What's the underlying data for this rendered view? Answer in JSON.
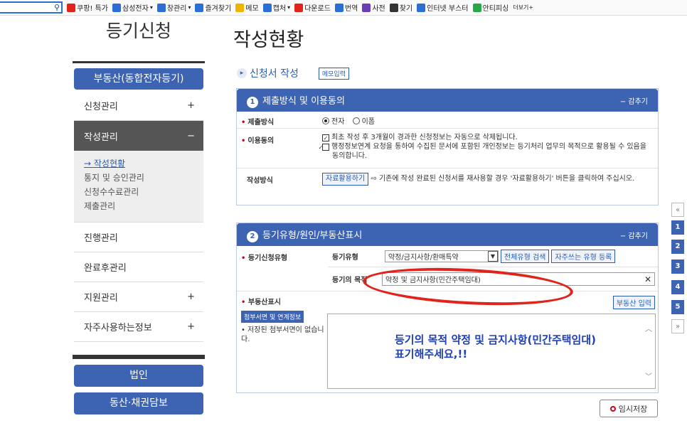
{
  "toolbar": {
    "items": [
      {
        "label": "쿠팡! 특가",
        "icon": "coupang-icon",
        "color": "#e0231b"
      },
      {
        "label": "삼성전자",
        "icon": "samsung-icon",
        "color": "#2b6fd6",
        "caret": true
      },
      {
        "label": "창관리",
        "icon": "window-icon",
        "color": "#2b6fd6",
        "caret": true
      },
      {
        "label": "즐겨찾기",
        "icon": "star-icon",
        "color": "#2b6fd6"
      },
      {
        "label": "메모",
        "icon": "memo-icon",
        "color": "#f0b400"
      },
      {
        "label": "캡처",
        "icon": "capture-icon",
        "color": "#2b6fd6",
        "caret": true
      },
      {
        "label": "다운로드",
        "icon": "download-icon",
        "color": "#e0231b"
      },
      {
        "label": "번역",
        "icon": "translate-icon",
        "color": "#2b6fd6"
      },
      {
        "label": "사전",
        "icon": "dictionary-icon",
        "color": "#6a3fb5"
      },
      {
        "label": "찾기",
        "icon": "find-icon",
        "color": "#333333"
      },
      {
        "label": "인터넷 부스터",
        "icon": "booster-icon",
        "color": "#2b6fd6"
      },
      {
        "label": "안티피싱",
        "icon": "shield-icon",
        "color": "#27a844"
      },
      {
        "label": "더보기+",
        "icon": "",
        "color": ""
      }
    ]
  },
  "sidebar": {
    "title": "등기신청",
    "category": "부동산(동합전자등기)",
    "menu": [
      {
        "label": "신청관리",
        "sign": "+"
      },
      {
        "label": "작성관리",
        "sign": "−",
        "active": true
      }
    ],
    "submenu": [
      "작성현황",
      "통지 및 승인관리",
      "신청수수료관리",
      "제출관리"
    ],
    "menu2": [
      {
        "label": "진행관리",
        "sign": ""
      },
      {
        "label": "완료후관리",
        "sign": ""
      },
      {
        "label": "지원관리",
        "sign": "+"
      },
      {
        "label": "자주사용하는정보",
        "sign": "+"
      }
    ],
    "buttons": [
      "법인",
      "동산·채권담보"
    ]
  },
  "page": {
    "title": "작성현황",
    "section": "신청서 작성",
    "memo_button": "메모입력"
  },
  "panel1": {
    "num": "1",
    "title": "제출방식 및 이용동의",
    "fold": "− 감추기",
    "method_label": "제출방식",
    "method_opts": [
      "전자",
      "이폼"
    ],
    "consent_label": "이용동의",
    "consent1": "최초 작성 후 3개월이 경과한 신청정보는 자동으로 삭제됩니다.",
    "consent2": "행정정보연계 요청을 통하여 수집된 문서에 포함된 개인정보는 등기처리 업무의 목적으로 활용될 수 있음을 동의합니다.",
    "write_label": "작성방식",
    "reuse_button": "자료활용하기",
    "reuse_desc": "기존에 작성 완료된 신청서를 재사용할 경우 '자료활용하기' 버튼을 클릭하여 주십시오."
  },
  "panel2": {
    "num": "2",
    "title": "등기유형/원인/부동산표시",
    "fold": "− 감추기",
    "type_label": "등기신청유형",
    "reg_type_label": "등기유형",
    "reg_type_value": "약정/금지사항/환매특약",
    "search_all_button": "전체유형 검색",
    "fav_button": "자주쓰는 유형 등록",
    "purpose_label": "등기의 목적",
    "purpose_value": "약정 및 금지사항(민간주택임대)",
    "property_label": "부동산표시",
    "attach_button": "첨부서면 및 연계정보",
    "attach_note": "저장된 첨부서면이 없습니다.",
    "property_input_button": "부동산 입력"
  },
  "annotation": {
    "line1": "등기의 목적 약정 및 금지사항(민간주택임대)",
    "line2": "표기해주세요,!!"
  },
  "save_button": "임시저장",
  "float_nav": [
    "«",
    "1",
    "2",
    "3",
    "4",
    "5",
    "»"
  ]
}
